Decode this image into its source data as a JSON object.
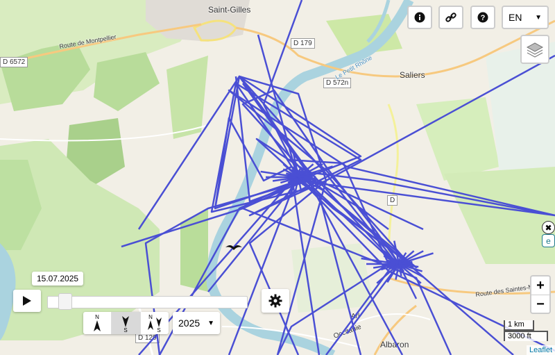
{
  "places": {
    "saint_gilles": "Saint-Gilles",
    "saliers": "Saliers",
    "albaron": "Albaron",
    "arles": "Arl",
    "occitanie": "Occitanie"
  },
  "roads": {
    "d6572": "D 6572",
    "d179": "D 179",
    "d572n": "D 572n",
    "d129": "D 129",
    "d_short": "D",
    "route_montpellier": "Route de Montpellier",
    "route_saintes_maries": "Route des Saintes-Maries",
    "petit_rhone": "Le Petit Rhône"
  },
  "top_controls": {
    "info_icon": "info-icon",
    "link_icon": "link-icon",
    "help_icon": "help-icon",
    "language": "EN"
  },
  "timeline": {
    "date": "15.07.2025",
    "year": "2025",
    "progress": 0.04
  },
  "orientation": {
    "north": "N",
    "south": "S"
  },
  "zoom": {
    "in": "+",
    "out": "−"
  },
  "scale": {
    "km": "1 km",
    "ft": "3000 ft"
  },
  "attribution": "Leaflet",
  "colors": {
    "track": "#4a4fd4",
    "water": "#aad3df",
    "field": "#cde8a6",
    "forest": "#add19e",
    "road": "#f7c97f"
  }
}
